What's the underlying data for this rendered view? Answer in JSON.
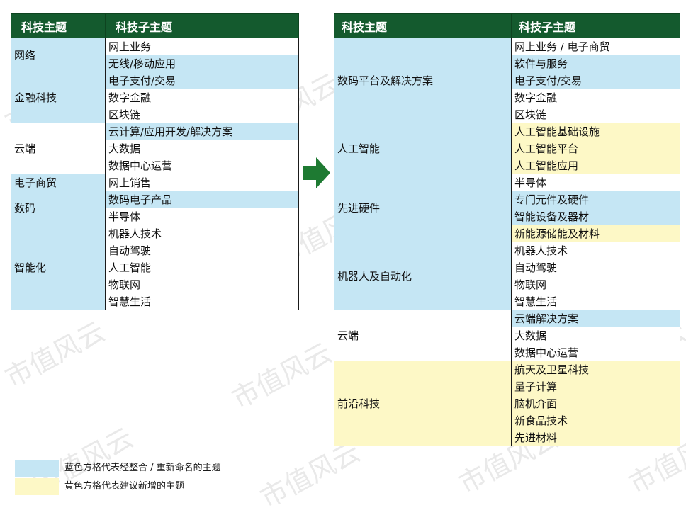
{
  "left_table": {
    "headers": [
      "科技主题",
      "科技子主题"
    ],
    "groups": [
      {
        "main": "网络",
        "main_color": "blue",
        "subs": [
          {
            "label": "网上业务",
            "color": "white"
          },
          {
            "label": "无线/移动应用",
            "color": "blue"
          }
        ]
      },
      {
        "main": "金融科技",
        "main_color": "blue",
        "subs": [
          {
            "label": "电子支付/交易",
            "color": "blue"
          },
          {
            "label": "数字金融",
            "color": "white"
          },
          {
            "label": "区块链",
            "color": "white"
          }
        ]
      },
      {
        "main": "云端",
        "main_color": "white",
        "subs": [
          {
            "label": "云计算/应用开发/解决方案",
            "color": "blue"
          },
          {
            "label": "大数据",
            "color": "white"
          },
          {
            "label": "数据中心运营",
            "color": "white"
          }
        ]
      },
      {
        "main": "电子商贸",
        "main_color": "blue",
        "subs": [
          {
            "label": "网上销售",
            "color": "white"
          }
        ]
      },
      {
        "main": "数码",
        "main_color": "blue",
        "subs": [
          {
            "label": "数码电子产品",
            "color": "blue"
          },
          {
            "label": "半导体",
            "color": "white"
          }
        ]
      },
      {
        "main": "智能化",
        "main_color": "blue",
        "subs": [
          {
            "label": "机器人技术",
            "color": "white"
          },
          {
            "label": "自动驾驶",
            "color": "white"
          },
          {
            "label": "人工智能",
            "color": "white"
          },
          {
            "label": "物联网",
            "color": "white"
          },
          {
            "label": "智慧生活",
            "color": "white"
          }
        ]
      }
    ]
  },
  "right_table": {
    "headers": [
      "科技主题",
      "科技子主题"
    ],
    "groups": [
      {
        "main": "数码平台及解决方案",
        "main_color": "blue",
        "subs": [
          {
            "label": "网上业务 / 电子商贸",
            "color": "white"
          },
          {
            "label": "软件与服务",
            "color": "blue"
          },
          {
            "label": "电子支付/交易",
            "color": "blue"
          },
          {
            "label": "数字金融",
            "color": "white"
          },
          {
            "label": "区块链",
            "color": "white"
          }
        ]
      },
      {
        "main": "人工智能",
        "main_color": "blue",
        "subs": [
          {
            "label": "人工智能基础设施",
            "color": "yellow"
          },
          {
            "label": "人工智能平台",
            "color": "yellow"
          },
          {
            "label": "人工智能应用",
            "color": "yellow"
          }
        ]
      },
      {
        "main": "先进硬件",
        "main_color": "blue",
        "subs": [
          {
            "label": "半导体",
            "color": "white"
          },
          {
            "label": "专门元件及硬件",
            "color": "blue"
          },
          {
            "label": "智能设备及器材",
            "color": "blue"
          },
          {
            "label": "新能源储能及材料",
            "color": "yellow"
          }
        ]
      },
      {
        "main": "机器人及自动化",
        "main_color": "blue",
        "subs": [
          {
            "label": "机器人技术",
            "color": "white"
          },
          {
            "label": "自动驾驶",
            "color": "white"
          },
          {
            "label": "物联网",
            "color": "white"
          },
          {
            "label": "智慧生活",
            "color": "white"
          }
        ]
      },
      {
        "main": "云端",
        "main_color": "white",
        "subs": [
          {
            "label": "云端解决方案",
            "color": "blue"
          },
          {
            "label": "大数据",
            "color": "white"
          },
          {
            "label": "数据中心运营",
            "color": "white"
          }
        ]
      },
      {
        "main": "前沿科技",
        "main_color": "yellow",
        "subs": [
          {
            "label": "航天及卫星科技",
            "color": "yellow"
          },
          {
            "label": "量子计算",
            "color": "yellow"
          },
          {
            "label": "脑机介面",
            "color": "yellow"
          },
          {
            "label": "新食品技术",
            "color": "yellow"
          },
          {
            "label": "先进材料",
            "color": "yellow"
          }
        ]
      }
    ]
  },
  "legend": {
    "blue_text": "蓝色方格代表经整合 / 重新命名的主题",
    "yellow_text": "黄色方格代表建议新增的主题"
  },
  "watermark_text": "市值风云",
  "colors": {
    "header_green": "#145a2e",
    "blue": "#c5e6f4",
    "yellow": "#fdf8c6",
    "arrow_green": "#1e7a32"
  }
}
